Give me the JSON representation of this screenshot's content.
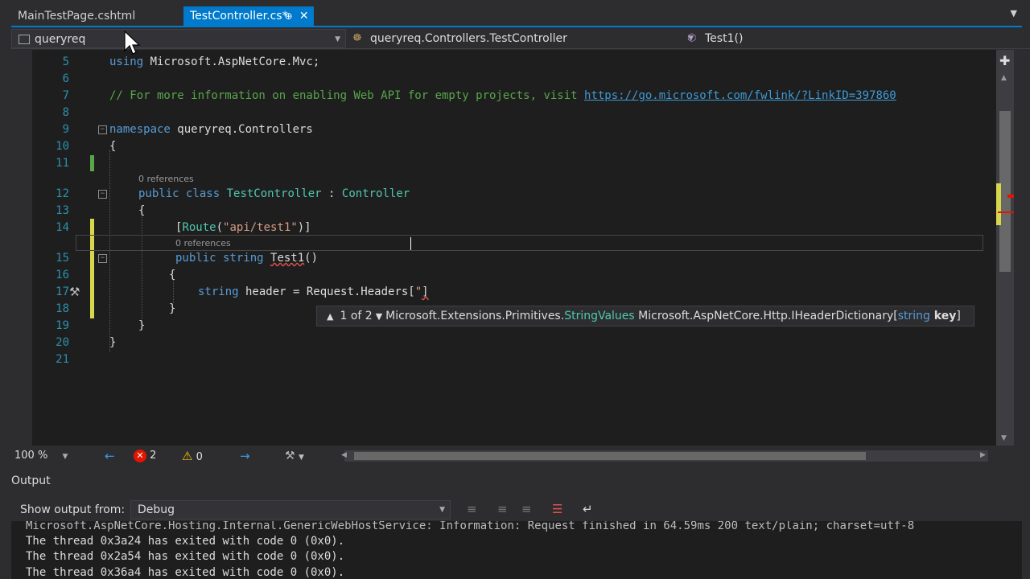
{
  "tabs": [
    {
      "label": "MainTestPage.cshtml",
      "active": false
    },
    {
      "label": "TestController.cs*",
      "active": true
    }
  ],
  "nav": {
    "project": "queryreq",
    "class": "queryreq.Controllers.TestController",
    "member": "Test1()"
  },
  "code": {
    "line_numbers": [
      "5",
      "6",
      "7",
      "8",
      "9",
      "10",
      "11",
      "12",
      "13",
      "14",
      "15",
      "16",
      "17",
      "18",
      "19",
      "20",
      "21"
    ],
    "line5": {
      "kw": "using",
      "rest": " Microsoft.AspNetCore.Mvc;"
    },
    "line7": {
      "comment": "// For more information on enabling Web API for empty projects, visit ",
      "link": "https://go.microsoft.com/fwlink/?LinkID=397860"
    },
    "line9": {
      "kw": "namespace",
      "rest": " queryreq.Controllers"
    },
    "brace_open": "{",
    "brace_close": "}",
    "ref_class": "0 references",
    "line12": {
      "kw1": "public",
      "kw2": " class ",
      "type": "TestController",
      "sep": " : ",
      "base": "Controller"
    },
    "line14": {
      "open": "[",
      "attr": "Route",
      "paren_open": "(",
      "str": "\"api/test1\"",
      "close": ")]"
    },
    "ref_method": "0 references",
    "line15": {
      "kw1": "public",
      "kw2": " string ",
      "name": "Test1",
      "rest": "()"
    },
    "line17": {
      "kw": "string",
      "rest": " header = Request.Headers[",
      "str": "\"",
      "tail": "]"
    }
  },
  "tooltip": {
    "counter": "1 of 2",
    "prefix": "Microsoft.Extensions.Primitives.",
    "type": "StringValues",
    "signature": " Microsoft.AspNetCore.Http.IHeaderDictionary[",
    "param_kw": "string",
    "param_name": " key",
    "close": "]"
  },
  "status": {
    "zoom": "100 %",
    "errors": "2",
    "warnings": "0"
  },
  "output": {
    "title": "Output",
    "show_from_label": "Show output from:",
    "source": "Debug",
    "lines": [
      "Microsoft.AspNetCore.Hosting.Internal.GenericWebHostService: Information: Request finished in 64.59ms 200 text/plain; charset=utf-8",
      "The thread 0x3a24 has exited with code 0 (0x0).",
      "The thread 0x2a54 has exited with code 0 (0x0).",
      "The thread 0x36a4 has exited with code 0 (0x0)."
    ]
  },
  "colors": {
    "accent": "#007acc",
    "keyword": "#569cd6",
    "type": "#4ec9b0",
    "string": "#d69d85",
    "comment": "#57a64a",
    "line_number": "#2b91af"
  }
}
